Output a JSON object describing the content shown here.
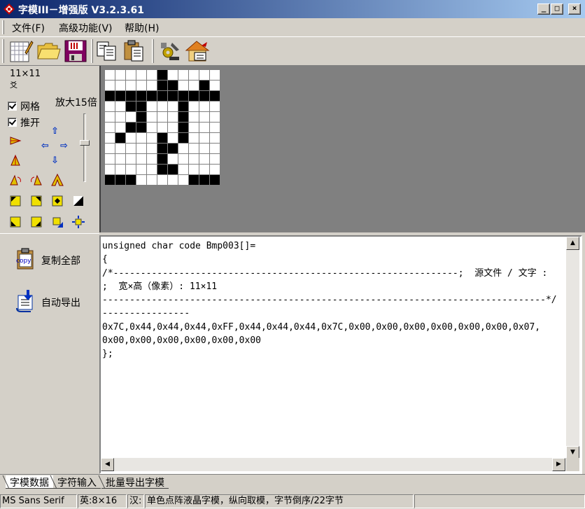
{
  "window": {
    "title": "字模III－增强版 V3.2.3.61",
    "minimize": "_",
    "maximize": "□",
    "close": "×"
  },
  "menu": {
    "items": [
      "文件(F)",
      "高级功能(V)",
      "帮助(H)"
    ]
  },
  "toolbar": {
    "buttons": [
      "new-icon",
      "open-folder-icon",
      "save-icon",
      "copy-icon",
      "paste-icon",
      "settings-icon",
      "export-icon"
    ]
  },
  "panel": {
    "size_label": "11×11",
    "glyph_char": "爻",
    "grid_label": "网格",
    "push_label": "推开",
    "zoom_label": "放大15倍",
    "grid_checked": true,
    "push_checked": true
  },
  "pixel_matrix": {
    "width": 11,
    "height": 11,
    "rows": [
      "00000100000",
      "00000110010",
      "11111111111",
      "00110001000",
      "00010001000",
      "00110001000",
      "01000101000",
      "00000110000",
      "00000100000",
      "00000110000",
      "11100000111"
    ]
  },
  "actions": {
    "copy_all": "复制全部",
    "auto_export": "自动导出",
    "copy_icon_text": "copy"
  },
  "code": {
    "lines": [
      "unsigned char code Bmp003[]=",
      "{",
      "/*---------------------------------------------------------------;  源文件 / 文字 :",
      ";  宽×高（像素）: 11×11",
      "---------------------------------------------------------------------------------*/",
      "----------------",
      "0x7C,0x44,0x44,0x44,0xFF,0x44,0x44,0x44,0x7C,0x00,0x00,0x00,0x00,0x00,0x00,0x07,",
      "0x00,0x00,0x00,0x00,0x00,0x00",
      "};"
    ]
  },
  "tabs": [
    "字模数据",
    "字符输入",
    "批量导出字模"
  ],
  "status": {
    "font": "MS Sans Serif",
    "en_size": "英:8×16",
    "cn_label": "汉:",
    "mode": "单色点阵液晶字模，纵向取模，字节倒序/22字节"
  }
}
